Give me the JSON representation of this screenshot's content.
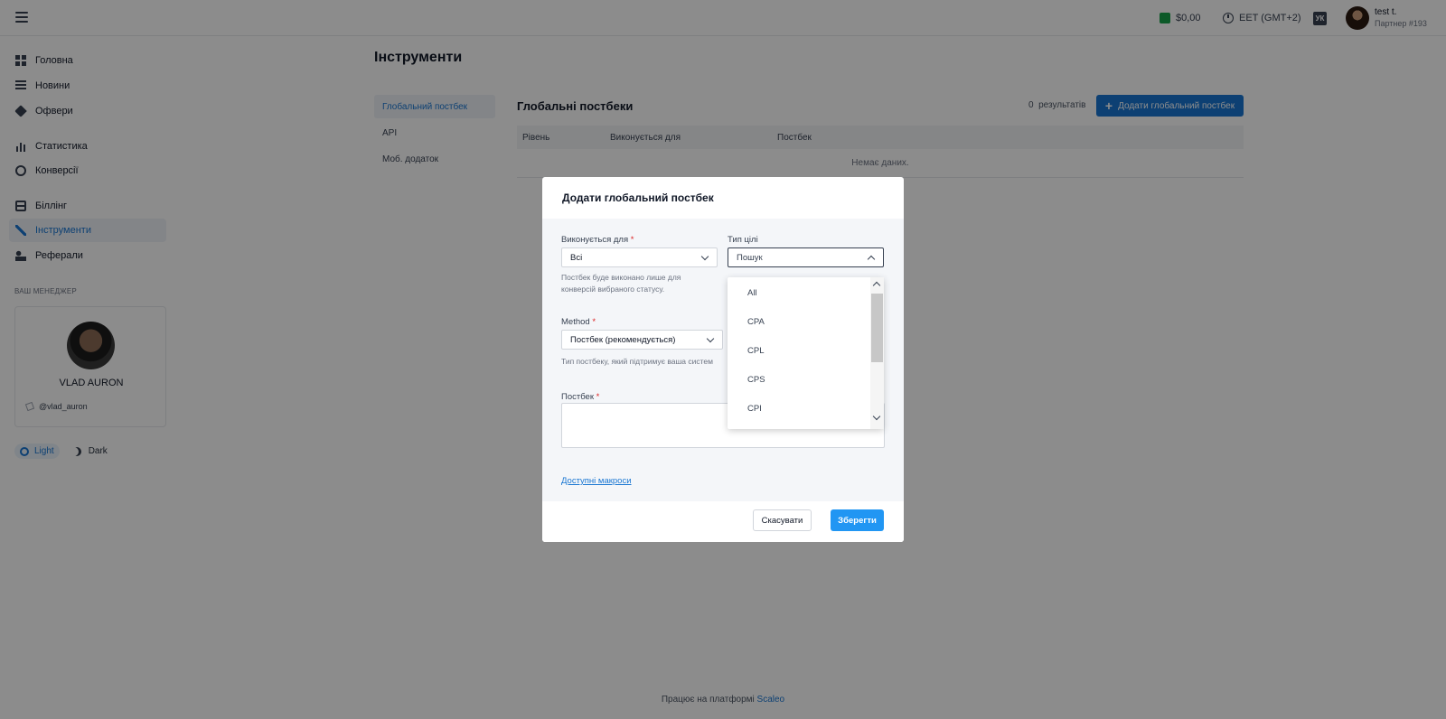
{
  "topbar": {
    "balance": "$0,00",
    "timezone": "EET (GMT+2)",
    "language": "УК",
    "user_name": "test t.",
    "user_sub": "Партнер #193"
  },
  "sidebar": {
    "items": [
      {
        "label": "Головна"
      },
      {
        "label": "Новини"
      },
      {
        "label": "Офвери"
      },
      {
        "label": "Статистика"
      },
      {
        "label": "Конверсії"
      },
      {
        "label": "Біллінг"
      },
      {
        "label": "Інструменти"
      },
      {
        "label": "Реферали"
      }
    ],
    "manager_title": "ВАШ МЕНЕДЖЕР",
    "manager_name": "VLAD AURON",
    "manager_handle": "@vlad_auron",
    "theme_light": "Light",
    "theme_dark": "Dark"
  },
  "page": {
    "title": "Інструменти",
    "subnav": [
      "Глобальний постбек",
      "API",
      "Моб. додаток"
    ],
    "section_title": "Глобальні постбеки",
    "results_count": "0",
    "results_label": "результатів",
    "add_button": "Додати глобальний постбек",
    "columns": [
      "Рівень",
      "Виконується для",
      "Постбек"
    ],
    "empty_text": "Немає даних.",
    "footer_text": "Працює на платформі",
    "footer_link": "Scaleo"
  },
  "modal": {
    "title": "Додати глобальний постбек",
    "executes_for_label": "Виконується для",
    "executes_for_value": "Всі",
    "executes_for_hint_1": "Постбек буде виконано лише для",
    "executes_for_hint_2": "конверсій вибраного статусу.",
    "goal_type_label": "Тип цілі",
    "goal_type_placeholder": "Пошук",
    "method_label": "Method",
    "method_value": "Постбек (рекомендується)",
    "method_hint": "Тип постбеку, який підтримує ваша систем",
    "postback_label": "Постбек",
    "macros_link": "Доступні макроси",
    "cancel": "Скасувати",
    "save": "Зберегти",
    "required_mark": "*"
  },
  "dropdown": {
    "options": [
      "All",
      "CPA",
      "CPL",
      "CPS",
      "CPI"
    ]
  }
}
